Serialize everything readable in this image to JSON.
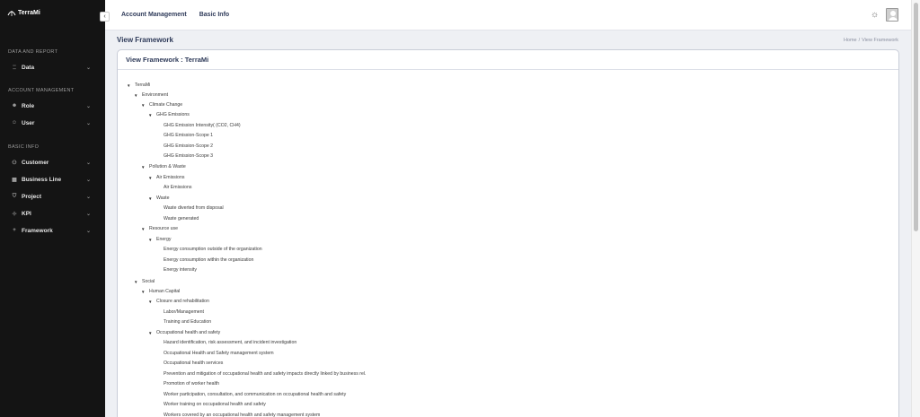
{
  "app": {
    "logo_text": "TerraMi"
  },
  "sidebar": {
    "sections": [
      {
        "title": "DATA AND REPORT"
      },
      {
        "title": "ACCOUNT MANAGEMENT"
      },
      {
        "title": "BASIC INFO"
      }
    ],
    "items": [
      {
        "label": "Data",
        "icon": "data-icon"
      },
      {
        "label": "Role",
        "icon": "role-icon"
      },
      {
        "label": "User",
        "icon": "user-icon"
      },
      {
        "label": "Customer",
        "icon": "customer-icon"
      },
      {
        "label": "Business Line",
        "icon": "business-line-icon"
      },
      {
        "label": "Project",
        "icon": "project-icon"
      },
      {
        "label": "KPI",
        "icon": "kpi-icon"
      },
      {
        "label": "Framework",
        "icon": "framework-icon"
      }
    ]
  },
  "header": {
    "nav": [
      "Account Management",
      "Basic Info"
    ]
  },
  "page": {
    "title": "View Framework",
    "breadcrumb": [
      "Home",
      "View Framework"
    ],
    "card_title": "View Framework : TerraMi"
  },
  "tree": [
    {
      "label": "TerraMi",
      "expanded": true
    },
    {
      "label": "Environment",
      "expanded": true
    },
    {
      "label": "Climate Change",
      "expanded": true
    },
    {
      "label": "GHG Emissions",
      "expanded": true
    },
    {
      "label": "GHG Emission Intensity( (CO2, CH4)"
    },
    {
      "label": "GHG Emission-Scope 1"
    },
    {
      "label": "GHG Emission-Scope 2"
    },
    {
      "label": "GHG Emission-Scope 3"
    },
    {
      "label": "Pollution & Waste",
      "expanded": true
    },
    {
      "label": "Air Emissions",
      "expanded": true
    },
    {
      "label": "Air Emissions"
    },
    {
      "label": "Waste",
      "expanded": true
    },
    {
      "label": "Waste diverted from disposal"
    },
    {
      "label": "Waste generated"
    },
    {
      "label": "Resource use",
      "expanded": true
    },
    {
      "label": "Energy",
      "expanded": true
    },
    {
      "label": "Energy consumption outside of the organization"
    },
    {
      "label": "Energy consumption within the organization"
    },
    {
      "label": "Energy intensity"
    },
    {
      "label": "Social",
      "expanded": true
    },
    {
      "label": "Human Capital",
      "expanded": true
    },
    {
      "label": "Closure and rehabilitation",
      "expanded": true
    },
    {
      "label": "Labor/Management"
    },
    {
      "label": "Training and Education"
    },
    {
      "label": "Occupational health and safety",
      "expanded": true
    },
    {
      "label": "Hazard identification, risk assessment, and incident investigation"
    },
    {
      "label": "Occupational Health and Safety management system"
    },
    {
      "label": "Occupational health services"
    },
    {
      "label": "Prevention and mitigation of occupational health and safety impacts directly linked by business rel."
    },
    {
      "label": "Promotion of worker health"
    },
    {
      "label": "Worker participation, consultation, and communication on occupational health and safety"
    },
    {
      "label": "Worker training on occupational health and safety"
    },
    {
      "label": "Workers covered by an occupational health and safety management system"
    }
  ],
  "colors": {
    "sidebar_bg": "#141414",
    "accent_text": "#2e3a59"
  }
}
